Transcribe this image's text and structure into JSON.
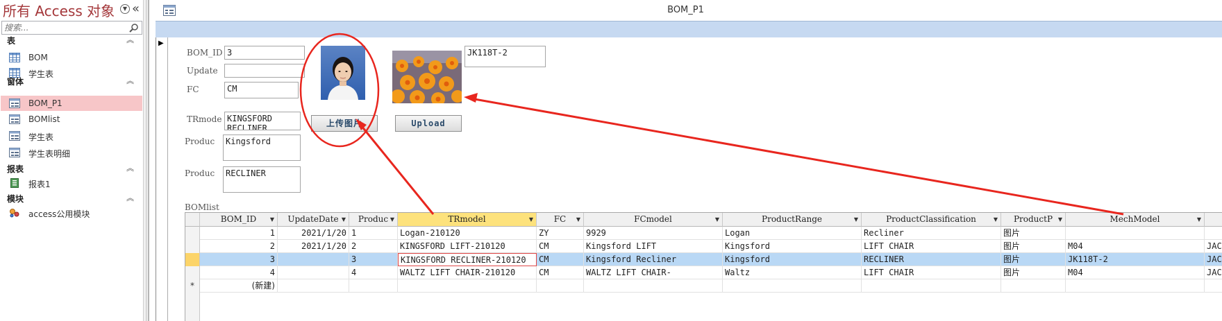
{
  "nav": {
    "title": "所有 Access 对象",
    "search_placeholder": "搜索...",
    "groups": [
      {
        "label": "表",
        "items": [
          {
            "label": "BOM",
            "icon": "table-icon"
          },
          {
            "label": "学生表",
            "icon": "table-icon"
          }
        ]
      },
      {
        "label": "窗体",
        "items": [
          {
            "label": "BOM_P1",
            "icon": "form-icon",
            "selected": true
          },
          {
            "label": "BOMlist",
            "icon": "form-icon"
          },
          {
            "label": "学生表",
            "icon": "form-icon"
          },
          {
            "label": "学生表明细",
            "icon": "form-icon"
          }
        ]
      },
      {
        "label": "报表",
        "items": [
          {
            "label": "报表1",
            "icon": "report-icon"
          }
        ]
      },
      {
        "label": "模块",
        "items": [
          {
            "label": "access公用模块",
            "icon": "module-icon"
          }
        ]
      }
    ]
  },
  "doc": {
    "title": "BOM_P1"
  },
  "form": {
    "labels": {
      "bom_id": "BOM_ID",
      "update": "Update",
      "fc": "FC",
      "trmode": "TRmode",
      "produc1": "Produc",
      "produc2": "Produc"
    },
    "values": {
      "bom_id": "3",
      "update": "",
      "fc": "CM",
      "trmode": "KINGSFORD\nRECLINER",
      "produc1": "Kingsford",
      "produc2": "RECLINER",
      "mechmodel": "JK118T-2"
    },
    "buttons": {
      "upload_cn": "上传图片",
      "upload_en": "Upload"
    }
  },
  "subform": {
    "label": "BOMlist",
    "columns": [
      "BOM_ID",
      "UpdateDate",
      "Produc",
      "TRmodel",
      "FC",
      "FCmodel",
      "ProductRange",
      "ProductClassification",
      "ProductP",
      "MechModel"
    ],
    "rows": [
      {
        "c": [
          "1",
          "2021/1/20",
          "1",
          "Logan-210120",
          "ZY",
          "9929",
          "Logan",
          "Recliner",
          "图片",
          "",
          ""
        ]
      },
      {
        "c": [
          "2",
          "2021/1/20",
          "2",
          "KINGSFORD LIFT-210120",
          "CM",
          "Kingsford LIFT",
          "Kingsford",
          "LIFT CHAIR",
          "图片",
          "M04",
          "JAC"
        ]
      },
      {
        "c": [
          "3",
          "",
          "3",
          "KINGSFORD RECLINER-210120",
          "CM",
          "Kingsford Recliner",
          "Kingsford",
          "RECLINER",
          "图片",
          "JK118T-2",
          "JAC"
        ]
      },
      {
        "c": [
          "4",
          "",
          "4",
          "WALTZ LIFT CHAIR-210120",
          "CM",
          "WALTZ  LIFT CHAIR-",
          "Waltz",
          "LIFT CHAIR",
          "图片",
          "M04",
          "JAC"
        ]
      }
    ],
    "new_row_label": "(新建)",
    "new_row_marker": "*"
  }
}
